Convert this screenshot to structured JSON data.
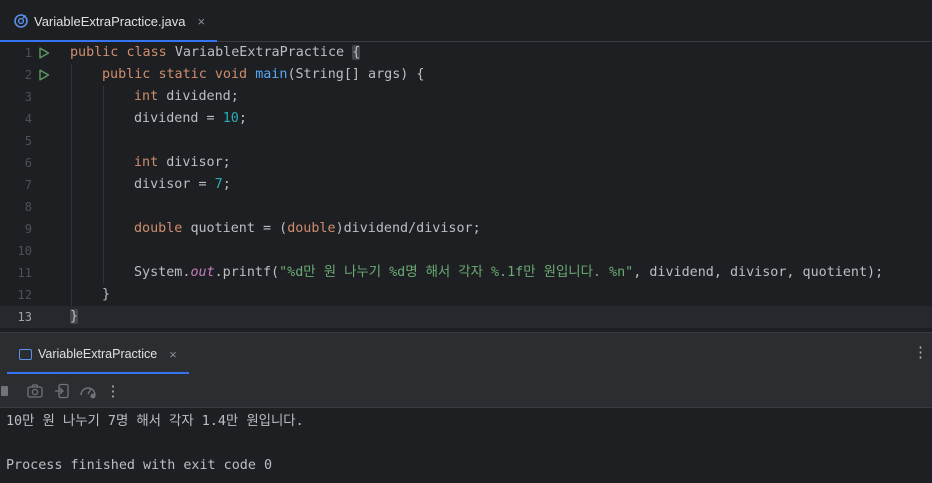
{
  "editor": {
    "tab": {
      "label": "VariableExtraPractice.java",
      "close": "×"
    },
    "lines": [
      {
        "n": "1"
      },
      {
        "n": "2"
      },
      {
        "n": "3"
      },
      {
        "n": "4"
      },
      {
        "n": "5"
      },
      {
        "n": "6"
      },
      {
        "n": "7"
      },
      {
        "n": "8"
      },
      {
        "n": "9"
      },
      {
        "n": "10"
      },
      {
        "n": "11"
      },
      {
        "n": "12"
      },
      {
        "n": "13"
      }
    ],
    "code": {
      "l1": {
        "kw1": "public",
        "kw2": "class",
        "name": "VariableExtraPractice",
        "brace": "{"
      },
      "l2": {
        "kw1": "public",
        "kw2": "static",
        "kw3": "void",
        "fn": "main",
        "rest": "(String[] args) {"
      },
      "l3": {
        "kw": "int",
        "rest": "dividend;"
      },
      "l4": {
        "lhs": "dividend = ",
        "num": "10",
        "end": ";"
      },
      "l6": {
        "kw": "int",
        "rest": "divisor;"
      },
      "l7": {
        "lhs": "divisor = ",
        "num": "7",
        "end": ";"
      },
      "l9": {
        "kw": "double",
        "mid": "quotient = (",
        "kw2": "double",
        "rest": ")dividend/divisor;"
      },
      "l11": {
        "obj": "System.",
        "fld": "out",
        "call": ".printf(",
        "str": "\"%d만 원 나누기 %d명 해서 각자 %.1f만 원입니다. %n\"",
        "rest": ", dividend, divisor, quotient);"
      },
      "l12": {
        "brace": "}"
      },
      "l13": {
        "brace": "}"
      }
    }
  },
  "run": {
    "tab": {
      "label": "VariableExtraPractice",
      "close": "×"
    },
    "menu": "⋮",
    "toolbar_menu": "⋮",
    "output": [
      "10만 원 나누기 7명 해서 각자 1.4만 원입니다.",
      "",
      "Process finished with exit code 0"
    ]
  },
  "colors": {
    "accent": "#3574f0",
    "keyword": "#cf8e6d",
    "function": "#56a8f5",
    "number": "#2aacb8",
    "string": "#6aab73",
    "field": "#c77dbb"
  }
}
